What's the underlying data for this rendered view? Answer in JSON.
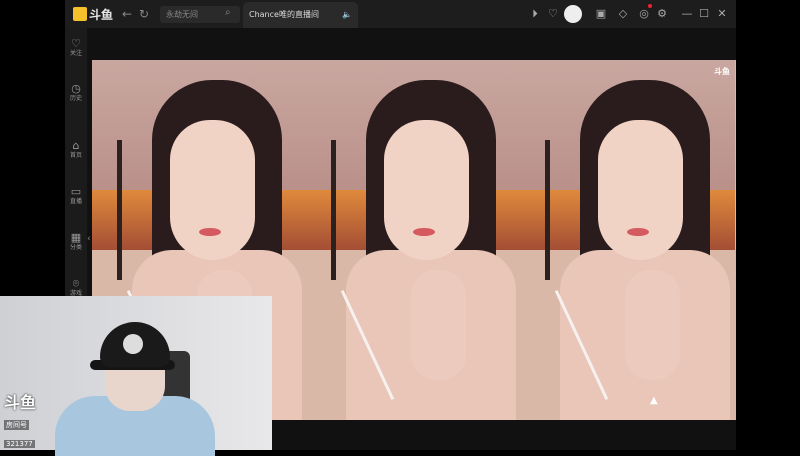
{
  "app": {
    "logo_text": "斗鱼",
    "search_placeholder": "永劫无间",
    "tab_title": "Chance唯的直播间",
    "sidebar": [
      {
        "icon": "heart-icon",
        "label": "关注"
      },
      {
        "icon": "clock-icon",
        "label": "历史"
      },
      {
        "icon": "home-icon",
        "label": "首页"
      },
      {
        "icon": "tv-icon",
        "label": "直播"
      },
      {
        "icon": "grid-icon",
        "label": "分类"
      },
      {
        "icon": "game-icon",
        "label": "游戏"
      }
    ]
  },
  "video": {
    "watermark": "斗鱼"
  },
  "cam": {
    "brand": "斗鱼",
    "room_label": "房间号",
    "room_number": "321377"
  },
  "colors": {
    "accent": "#f5c22b",
    "titlebar": "#1d1d1d",
    "notification": "#e22233"
  }
}
